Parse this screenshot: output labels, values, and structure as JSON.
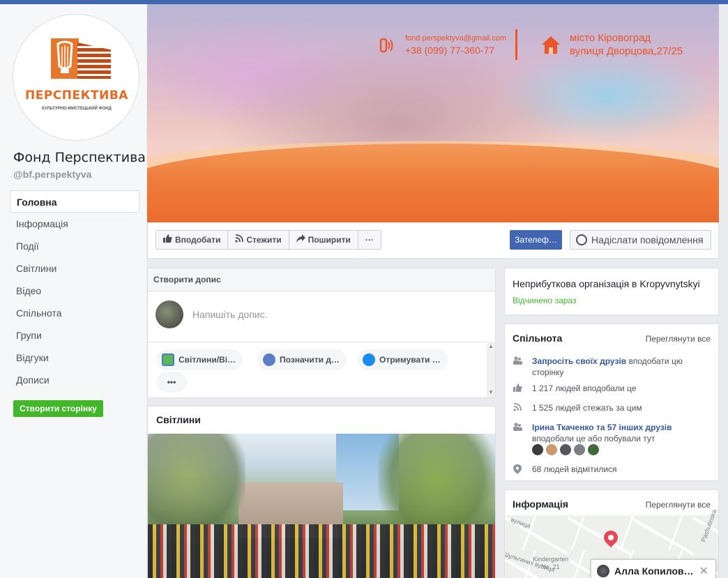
{
  "page": {
    "name": "Фонд Перспектива",
    "handle": "@bf.perspektyva",
    "logo_title": "ПЕРСПЕКТИВА",
    "logo_subtitle": "КУЛЬТУРНО-МИСТЕЦЬКИЙ ФОНД"
  },
  "nav": {
    "items": [
      {
        "label": "Головна",
        "active": true
      },
      {
        "label": "Інформація"
      },
      {
        "label": "Події"
      },
      {
        "label": "Світлини"
      },
      {
        "label": "Відео"
      },
      {
        "label": "Спільнота"
      },
      {
        "label": "Групи"
      },
      {
        "label": "Відгуки"
      },
      {
        "label": "Дописи"
      }
    ],
    "create_page": "Створити сторінку"
  },
  "cover": {
    "email": "fond.perspektyva@gmail.com",
    "phone": "+38 (099) 77-360-77",
    "city": "місто Кіровоград",
    "street": "вулиця Дворцова,27/25",
    "accent": "#e8562a"
  },
  "actions": {
    "like": "Вподобати",
    "follow": "Стежити",
    "share": "Поширити",
    "more": "···",
    "call": "Зателеф…",
    "message": "Надіслати повідомлення"
  },
  "create_post": {
    "header": "Створити допис",
    "placeholder": "Напишіть допис.",
    "options": [
      "Світлини/Ві…",
      "Позначити д…",
      "Отримувати …"
    ],
    "more": "•••"
  },
  "photos": {
    "title": "Світлини"
  },
  "about": {
    "title": "Неприбуткова організація в Kropyvnytskyi",
    "status": "Відчинено зараз"
  },
  "community": {
    "title": "Спільнота",
    "see_all": "Переглянути все",
    "invite_link": "Запросіть своїх друзів",
    "invite_rest": " вподобати цю сторінку",
    "likes": "1 217 людей вподобали це",
    "follows": "1 525 людей стежать за цим",
    "friends_link": "Ірина Ткаченко та 57 інших друзів",
    "friends_rest": "вподобали це або побували тут",
    "checkins": "68 людей відмітилися"
  },
  "info": {
    "title": "Інформація",
    "see_all": "Переглянути все",
    "map_labels": [
      "Kindergarten",
      "No. 21",
      "Шульгиних вулиця",
      "Pashutinska",
      "вулиця"
    ]
  },
  "chat": {
    "name": "Алла Копилов…",
    "close": "✕"
  },
  "colors": {
    "facebook_blue": "#4267b2",
    "green": "#42b72a",
    "link_blue": "#365899"
  }
}
